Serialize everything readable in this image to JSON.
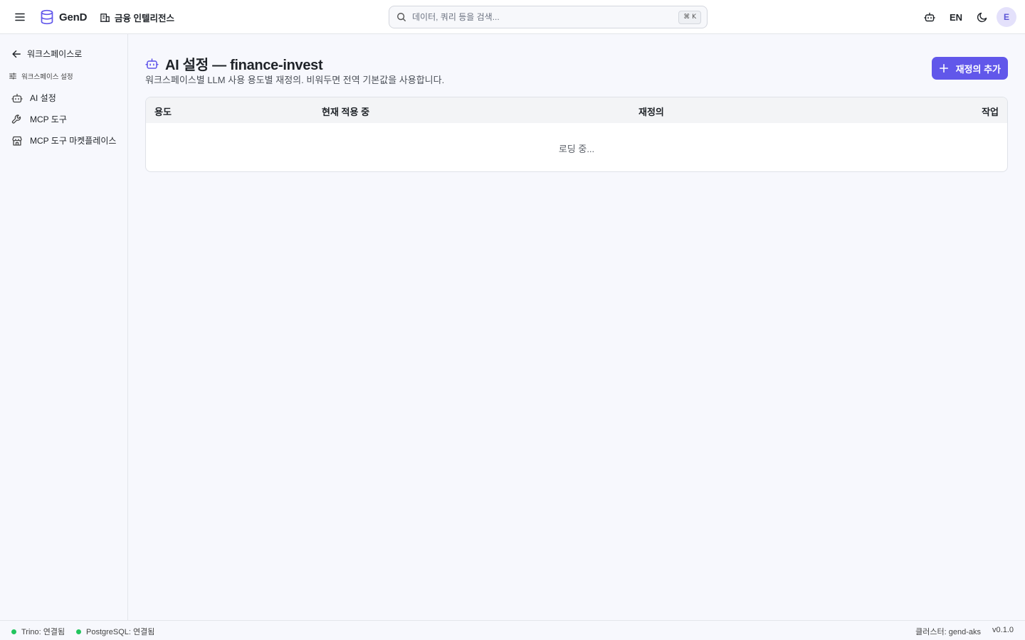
{
  "header": {
    "brand": "GenD",
    "workspace": "금융 인텔리전스",
    "search": {
      "placeholder": "데이터, 쿼리 등을 검색...",
      "shortcut": "⌘ K"
    },
    "lang": "EN",
    "avatar_initial": "E"
  },
  "sidebar": {
    "back_label": "워크스페이스로",
    "section_title": "워크스페이스 설정",
    "items": [
      {
        "label": "AI 설정",
        "icon": "bot-icon"
      },
      {
        "label": "MCP 도구",
        "icon": "wrench-icon"
      },
      {
        "label": "MCP 도구 마켓플레이스",
        "icon": "store-icon"
      }
    ]
  },
  "main": {
    "title": "AI 설정 — finance-invest",
    "subtitle": "워크스페이스별 LLM 사용 용도별 재정의. 비워두면 전역 기본값을 사용합니다.",
    "add_button": "재정의 추가",
    "table": {
      "columns": [
        "용도",
        "현재 적용 중",
        "재정의",
        "작업"
      ],
      "loading_text": "로딩 중..."
    }
  },
  "footer": {
    "statuses": [
      {
        "text": "Trino: 연결됨",
        "color": "#22c55e"
      },
      {
        "text": "PostgreSQL: 연결됨",
        "color": "#22c55e"
      }
    ],
    "cluster": "클러스터: gend-aks",
    "version": "v0.1.0"
  },
  "colors": {
    "accent": "#6157ea",
    "status_ok": "#22c55e"
  }
}
